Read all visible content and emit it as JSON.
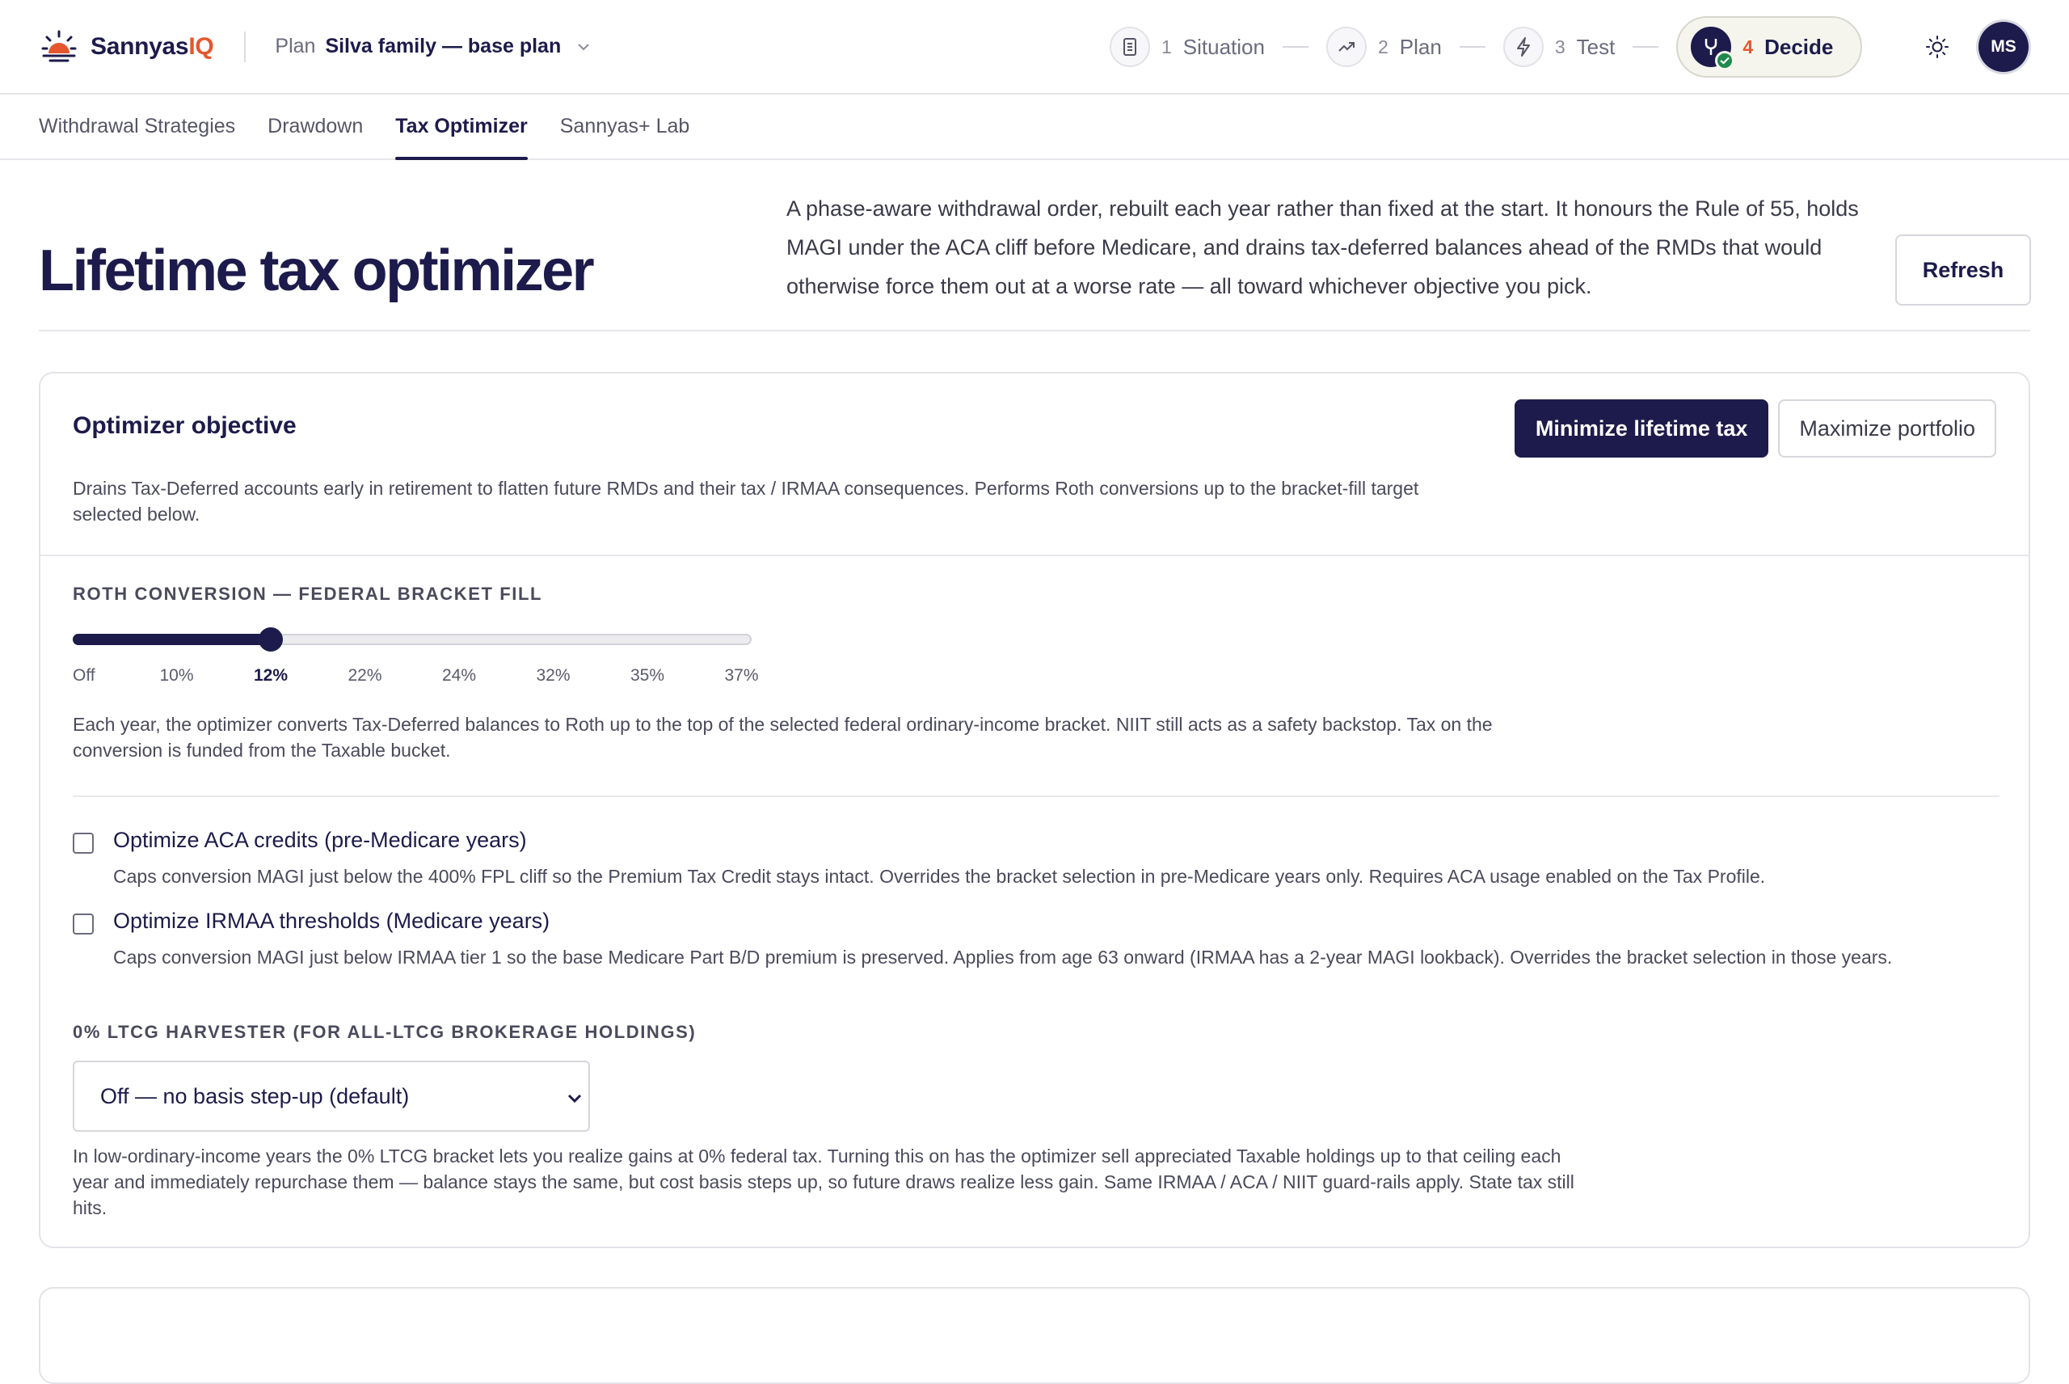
{
  "brand": {
    "name": "Sannyas",
    "suffix": "IQ"
  },
  "plan": {
    "label": "Plan",
    "value": "Silva family — base plan"
  },
  "steps": [
    {
      "num": "1",
      "label": "Situation",
      "icon": "document-icon"
    },
    {
      "num": "2",
      "label": "Plan",
      "icon": "trend-up-icon"
    },
    {
      "num": "3",
      "label": "Test",
      "icon": "lightning-icon"
    },
    {
      "num": "4",
      "label": "Decide",
      "icon": "fork-icon"
    }
  ],
  "avatar": "MS",
  "subnav": [
    "Withdrawal Strategies",
    "Drawdown",
    "Tax Optimizer",
    "Sannyas+ Lab"
  ],
  "header": {
    "title": "Lifetime tax optimizer",
    "intro": "A phase-aware withdrawal order, rebuilt each year rather than fixed at the start. It honours the Rule of 55, holds MAGI under the ACA cliff before Medicare, and drains tax-deferred balances ahead of the RMDs that would otherwise force them out at a worse rate — all toward whichever objective you pick.",
    "refresh": "Refresh"
  },
  "objective": {
    "title": "Optimizer objective",
    "primary": "Minimize lifetime tax",
    "secondary": "Maximize portfolio",
    "description": "Drains Tax-Deferred accounts early in retirement to flatten future RMDs and their tax / IRMAA consequences. Performs Roth conversions up to the bracket-fill target selected below."
  },
  "roth": {
    "label": "ROTH CONVERSION — FEDERAL BRACKET FILL",
    "ticks": [
      "Off",
      "10%",
      "12%",
      "22%",
      "24%",
      "32%",
      "35%",
      "37%"
    ],
    "selected_index": 2,
    "note": "Each year, the optimizer converts Tax-Deferred balances to Roth up to the top of the selected federal ordinary-income bracket. NIIT still acts as a safety backstop. Tax on the conversion is funded from the Taxable bucket."
  },
  "aca": {
    "title": "Optimize ACA credits (pre-Medicare years)",
    "desc": "Caps conversion MAGI just below the 400% FPL cliff so the Premium Tax Credit stays intact. Overrides the bracket selection in pre-Medicare years only. Requires ACA usage enabled on the Tax Profile.",
    "checked": false
  },
  "irmaa": {
    "title": "Optimize IRMAA thresholds (Medicare years)",
    "desc": "Caps conversion MAGI just below IRMAA tier 1 so the base Medicare Part B/D premium is preserved. Applies from age 63 onward (IRMAA has a 2-year MAGI lookback). Overrides the bracket selection in those years.",
    "checked": false
  },
  "ltcg": {
    "label": "0% LTCG HARVESTER (FOR ALL-LTCG BROKERAGE HOLDINGS)",
    "selected": "Off — no basis step-up (default)",
    "note": "In low-ordinary-income years the 0% LTCG bracket lets you realize gains at 0% federal tax. Turning this on has the optimizer sell appreciated Taxable holdings up to that ceiling each year and immediately repurchase them — balance stays the same, but cost basis steps up, so future draws realize less gain. Same IRMAA / ACA / NIIT guard-rails apply. State tax still hits."
  },
  "colors": {
    "navy": "#1d1b4b",
    "accent": "#e4572e",
    "success": "#1e8a4c"
  }
}
